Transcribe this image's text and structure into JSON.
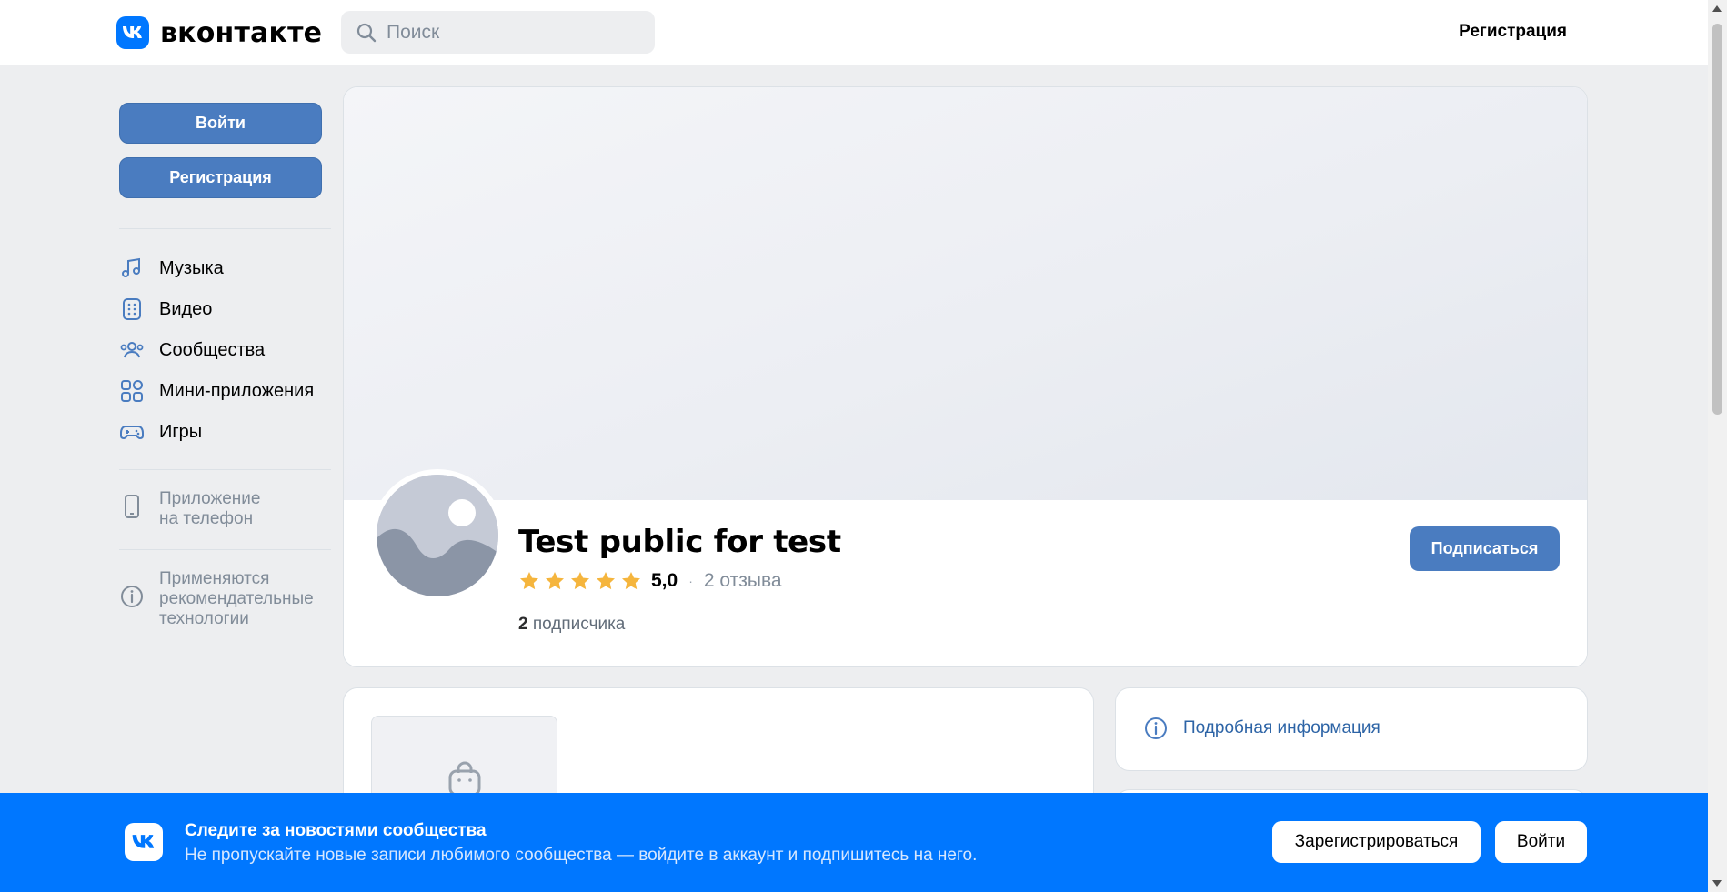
{
  "header": {
    "logo_text": "вконтакте",
    "search_placeholder": "Поиск",
    "register_link": "Регистрация"
  },
  "sidebar": {
    "login_button": "Войти",
    "register_button": "Регистрация",
    "nav_items": [
      {
        "label": "Музыка",
        "icon": "music-icon"
      },
      {
        "label": "Видео",
        "icon": "video-icon"
      },
      {
        "label": "Сообщества",
        "icon": "communities-icon"
      },
      {
        "label": "Мини-приложения",
        "icon": "mini-apps-icon"
      },
      {
        "label": "Игры",
        "icon": "gamepad-icon"
      }
    ],
    "phone_app_line1": "Приложение",
    "phone_app_line2": "на телефон",
    "recommend_line1": "Применяются",
    "recommend_line2": "рекомендательные",
    "recommend_line3": "технологии"
  },
  "group": {
    "name": "Test public for test",
    "rating": "5,0",
    "stars": 5,
    "reviews": "2 отзыва",
    "subscribers_count": "2",
    "subscribers_label": " подписчика",
    "subscribe_button": "Подписаться"
  },
  "info": {
    "details_link": "Подробная информация"
  },
  "banner": {
    "title": "Следите за новостями сообщества",
    "text": "Не пропускайте новые записи любимого сообщества — войдите в аккаунт и подпишитесь на него.",
    "register_button": "Зарегистрироваться",
    "login_button": "Войти"
  },
  "colors": {
    "brand": "#0077ff",
    "button": "#4a7cc0",
    "star": "#f5b53d",
    "link": "#2d64a6"
  }
}
